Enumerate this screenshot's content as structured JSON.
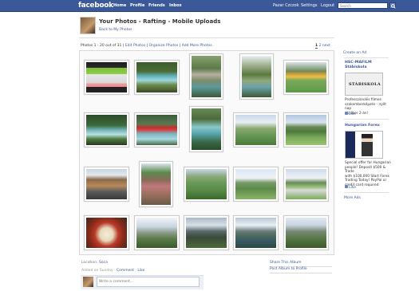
{
  "topbar": {
    "logo": "facebook",
    "nav": [
      "Home",
      "Profile",
      "Friends",
      "Inbox"
    ],
    "user_name": "Pazar Czczok",
    "settings": "Settings",
    "logout": "Logout",
    "search_placeholder": "Search"
  },
  "header": {
    "title": "Your Photos - Rafting - Mobile Uploads",
    "back_link": "Back to My Photos"
  },
  "subheader": {
    "count": "Photos 1 - 20 out of 31",
    "edit_photos": "Edit Photos",
    "organize_photos": "Organize Photos",
    "add_more": "Add More Photos",
    "page_current": "1",
    "page_other": "2",
    "next": "next"
  },
  "photos": [
    {
      "theme": "screen"
    },
    {
      "theme": "river"
    },
    {
      "theme": "bridge"
    },
    {
      "theme": "stream"
    },
    {
      "theme": "sheep"
    },
    {
      "theme": "rapids"
    },
    {
      "theme": "raft"
    },
    {
      "theme": "canyon"
    },
    {
      "theme": "valley"
    },
    {
      "theme": "meadow"
    },
    {
      "theme": "house"
    },
    {
      "theme": "cabin"
    },
    {
      "theme": "field"
    },
    {
      "theme": "hills"
    },
    {
      "theme": "village"
    },
    {
      "theme": "food"
    },
    {
      "theme": "peaks"
    },
    {
      "theme": "alps"
    },
    {
      "theme": "lake"
    },
    {
      "theme": "mountain"
    }
  ],
  "footer": {
    "location_label": "Location:",
    "location_value": "Soca",
    "added_on": "Added on Sunday",
    "comment": "Comment",
    "like": "Like",
    "comment_placeholder": "Write a comment...",
    "share_album": "Share This Album",
    "post_album": "Post Album to Profile"
  },
  "ads": {
    "create_ad": "Create an Ad",
    "ad1_title_line1": "HSC-MAFILM",
    "ad1_title_line2": "Stábiskola",
    "ad1_image_text": "STÁBISKOLA",
    "ad1_text": [
      "Professzionális filmes",
      "szakemberképzés - nyílt nap",
      "október 2-án!"
    ],
    "ad1_like": "Like",
    "ad2_title": "Hungarian Forex",
    "ad2_text": [
      "Special offer for Hungarian",
      "people! Deposit $500 & Trade",
      "with $100,000 Start Forex",
      "Trading Today! PayPal or",
      "credit card required"
    ],
    "ad2_like": "Like",
    "more_ads": "More Ads"
  },
  "colors": {
    "brand": "#3b5998",
    "link": "#3b5998"
  }
}
